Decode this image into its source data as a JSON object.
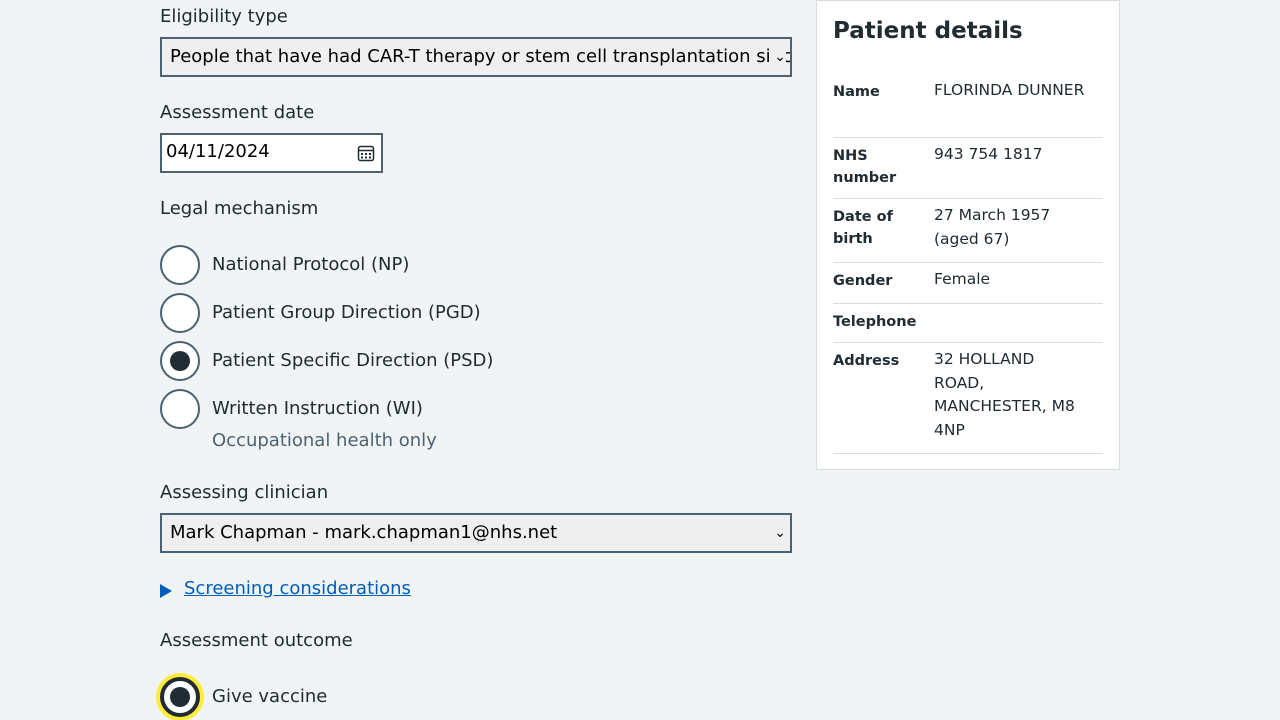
{
  "form": {
    "eligibility": {
      "label": "Eligibility type",
      "selected": "People that have had CAR-T therapy or stem cell transplantation since their last dose"
    },
    "assessment_date": {
      "label": "Assessment date",
      "value": "04/11/2024"
    },
    "legal_mechanism": {
      "label": "Legal mechanism",
      "options": [
        {
          "label": "National Protocol (NP)",
          "checked": false
        },
        {
          "label": "Patient Group Direction (PGD)",
          "checked": false
        },
        {
          "label": "Patient Specific Direction (PSD)",
          "checked": true
        },
        {
          "label": "Written Instruction (WI)",
          "checked": false,
          "hint": "Occupational health only"
        }
      ]
    },
    "clinician": {
      "label": "Assessing clinician",
      "selected": "Mark Chapman - mark.chapman1@nhs.net"
    },
    "screening_link": "Screening considerations",
    "outcome": {
      "label": "Assessment outcome",
      "options": [
        {
          "label": "Give vaccine",
          "checked": true
        }
      ]
    }
  },
  "patient": {
    "title": "Patient details",
    "rows": [
      {
        "key": "Name",
        "value": "FLORINDA DUNNER"
      },
      {
        "key": "NHS number",
        "value": "943 754 1817"
      },
      {
        "key": "Date of birth",
        "value": "27 March 1957 (aged 67)"
      },
      {
        "key": "Gender",
        "value": "Female"
      },
      {
        "key": "Telephone",
        "value": ""
      },
      {
        "key": "Address",
        "value": "32 HOLLAND ROAD, MANCHESTER, M8 4NP"
      }
    ]
  },
  "colors": {
    "background": "#f0f4f5",
    "text": "#212b32",
    "border": "#4c6272",
    "link": "#005eb8",
    "focus": "#ffeb3b"
  }
}
